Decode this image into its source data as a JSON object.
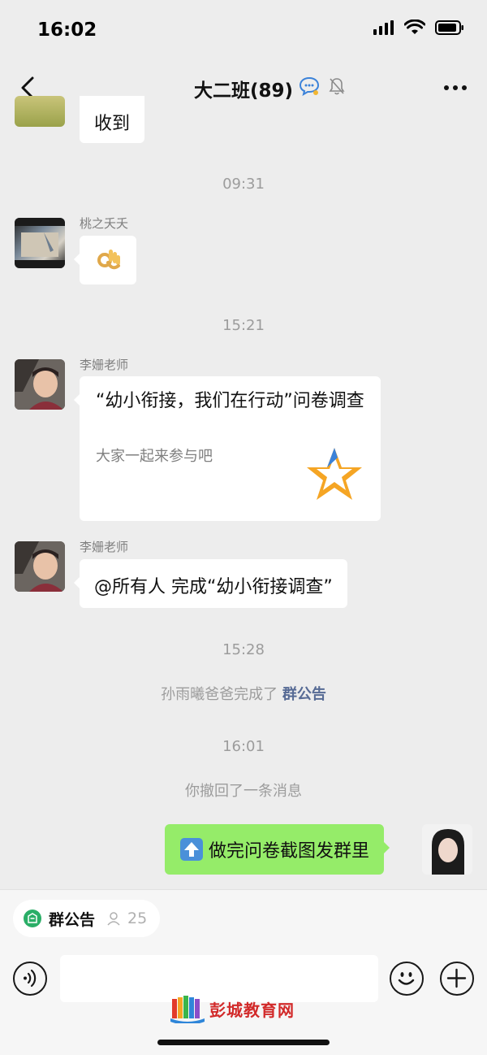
{
  "status": {
    "time": "16:02"
  },
  "nav": {
    "title": "大二班(89)"
  },
  "messages": {
    "prev_text": "收到",
    "time1": "09:31",
    "sender1": "桃之夭夭",
    "time2": "15:21",
    "sender2": "李姗老师",
    "card_title": "“幼小衔接，我们在行动”问卷调查",
    "card_desc": "大家一起来参与吧",
    "sender3": "李姗老师",
    "mention_text": "@所有人 完成“幼小衔接调查”",
    "time3": "15:28",
    "sys_prefix": "孙雨曦爸爸完成了",
    "sys_link": "群公告",
    "time4": "16:01",
    "recall_msg": "你撤回了一条消息",
    "sent_text": "做完问卷截图发群里"
  },
  "bottom": {
    "notice_label": "群公告",
    "notice_count": "25",
    "watermark": "彭城教育网"
  },
  "colors": {
    "sent_bubble": "#95ec69",
    "link": "#576b95",
    "background": "#ededed"
  }
}
